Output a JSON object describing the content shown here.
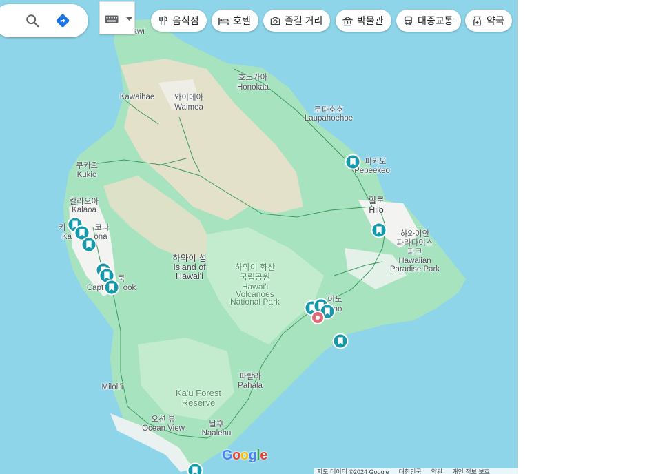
{
  "toolbar": {
    "chips": [
      {
        "label": "음식점",
        "icon": "restaurant-icon"
      },
      {
        "label": "호텔",
        "icon": "hotel-icon"
      },
      {
        "label": "즐길 거리",
        "icon": "camera-icon"
      },
      {
        "label": "박물관",
        "icon": "museum-icon"
      },
      {
        "label": "대중교통",
        "icon": "transit-icon"
      },
      {
        "label": "약국",
        "icon": "pharmacy-icon"
      }
    ]
  },
  "map": {
    "colors": {
      "water": "#8fd5ea",
      "land_green": "#a8e3c0",
      "park": "#c3eccf",
      "desert": "#eee0cb",
      "urban": "#f3f4f2",
      "pin": "#1598a9",
      "red_pin": "#e06a78"
    },
    "labels": {
      "hawi": "Hawi",
      "honokaa_ko": "호노카아",
      "honokaa_en": "Honokaa",
      "kawaihae": "Kawaihae",
      "waimea_ko": "와이메아",
      "waimea_en": "Waimea",
      "laupahoehoe_ko": "로파호호",
      "laupahoehoe_en": "Laupahoehoe",
      "pepeekeo_ko": "피키오",
      "pepeekeo_en": "Pepeekeo",
      "kukio_ko": "쿠키오",
      "kukio_en": "Kukio",
      "kalaoa_ko": "칼라오아",
      "kalaoa_en": "Kalaoa",
      "kona_ko": "코나",
      "kona_en": "ona",
      "kailua_ko": "키",
      "kailua_en": "Ka",
      "hilo_ko": "힐로",
      "hilo_en": "Hilo",
      "paradise_ko1": "하와이안",
      "paradise_ko2": "파라다이스",
      "paradise_ko3": "파크",
      "paradise_en1": "Hawaiian",
      "paradise_en2": "Paradise Park",
      "island_ko": "하와이 섬",
      "island_en1": "Island of",
      "island_en2": "Hawai'i",
      "volcano_park_ko1": "하와이 화산",
      "volcano_park_ko2": "국립공원",
      "volcano_park_en1": "Hawai'i",
      "volcano_park_en2": "Volcanoes",
      "volcano_park_en3": "National Park",
      "captain_ko": "쿡",
      "captain_en1": "Capt",
      "captain_en2": "ook",
      "volcano_ko": "이노",
      "volcano_en": "no",
      "pahala_ko": "파할라",
      "pahala_en": "Pahala",
      "forest_en1": "Ka'u Forest",
      "forest_en2": "Reserve",
      "milolii": "Miloli'i",
      "ocean_view_ko": "오션 뷰",
      "ocean_view_en": "Ocean View",
      "naalehu_ko": "날후",
      "naalehu_en": "Naalehu"
    },
    "google_logo": "Google",
    "footer": [
      "지도 데이터 ©2024 Google",
      "대한민국",
      "약관",
      "개인 정보 보호"
    ]
  }
}
